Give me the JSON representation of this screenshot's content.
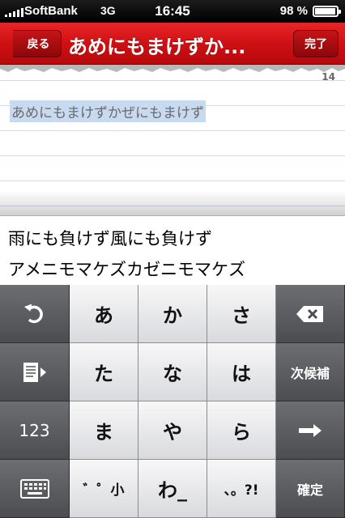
{
  "status": {
    "carrier": "SoftBank",
    "network": "3G",
    "time": "16:45",
    "battery_pct": "98 %",
    "battery_level": 0.98,
    "signal_bars": 5
  },
  "nav": {
    "back_label": "戻る",
    "title": "あめにもまけずか...",
    "done_label": "完了"
  },
  "memo": {
    "char_count": "14",
    "text": "あめにもまけずかぜにもまけず"
  },
  "candidates": [
    "雨にも負けず風にも負けず",
    "アメニモマケズカゼニモマケズ"
  ],
  "keyboard": {
    "rows": [
      [
        "あ",
        "か",
        "さ"
      ],
      [
        "た",
        "な",
        "は"
      ],
      [
        "ま",
        "や",
        "ら"
      ],
      [
        "゛゜小",
        "わ_",
        "、。?!"
      ]
    ],
    "next_candidate_label": "次候補",
    "numbers_label": "123",
    "confirm_label": "確定"
  },
  "colors": {
    "nav_red": "#cf1013",
    "selection": "#c8daf0"
  }
}
